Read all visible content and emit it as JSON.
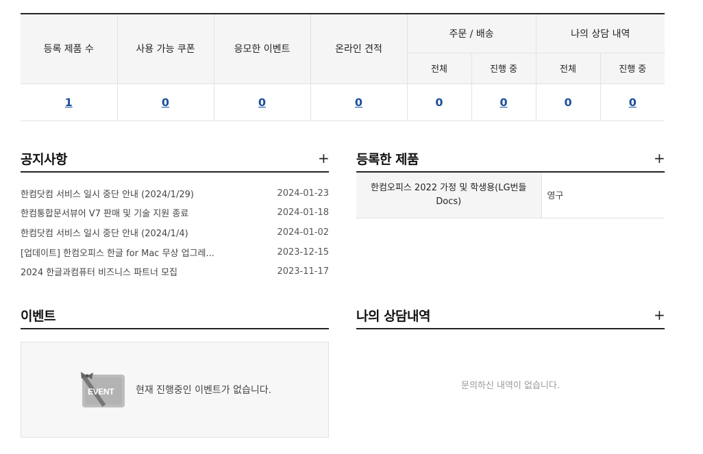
{
  "summary": {
    "headers": {
      "registered_products": "등록 제품 수",
      "usable_coupons": "사용 가능 쿠폰",
      "applied_events": "응모한 이벤트",
      "online_quote": "온라인 견적",
      "order_delivery": "주문 / 배송",
      "my_consultation": "나의 상담 내역",
      "all": "전체",
      "in_progress": "진행 중"
    },
    "values": {
      "registered_products": "1",
      "usable_coupons": "0",
      "applied_events": "0",
      "online_quote": "0",
      "order_all": "0",
      "order_in_progress": "0",
      "consult_all": "0",
      "consult_in_progress": "0"
    }
  },
  "notice": {
    "title": "공지사항",
    "more": "+",
    "items": [
      {
        "title": "한컴닷컴 서비스 일시 중단 안내 (2024/1/29)",
        "date": "2024-01-23"
      },
      {
        "title": "한컴통합문서뷰어 V7 판매 및 기술 지원 종료",
        "date": "2024-01-18"
      },
      {
        "title": "한컴닷컴 서비스 일시 중단 안내 (2024/1/4)",
        "date": "2024-01-02"
      },
      {
        "title": "[업데이트] 한컴오피스 한글 for Mac 무상 업그레...",
        "date": "2023-12-15"
      },
      {
        "title": "2024 한글과컴퓨터 비즈니스 파트너 모집",
        "date": "2023-11-17"
      }
    ]
  },
  "products": {
    "title": "등록한 제품",
    "more": "+",
    "items": [
      {
        "name": "한컴오피스 2022 가정 및 학생용(LG번들 Docs)",
        "term": "영구"
      }
    ]
  },
  "event": {
    "title": "이벤트",
    "icon_label": "EVENT",
    "empty_message": "현재 진행중인 이벤트가 없습니다."
  },
  "consultation": {
    "title": "나의 상담내역",
    "more": "+",
    "empty_message": "문의하신 내역이 없습니다."
  }
}
